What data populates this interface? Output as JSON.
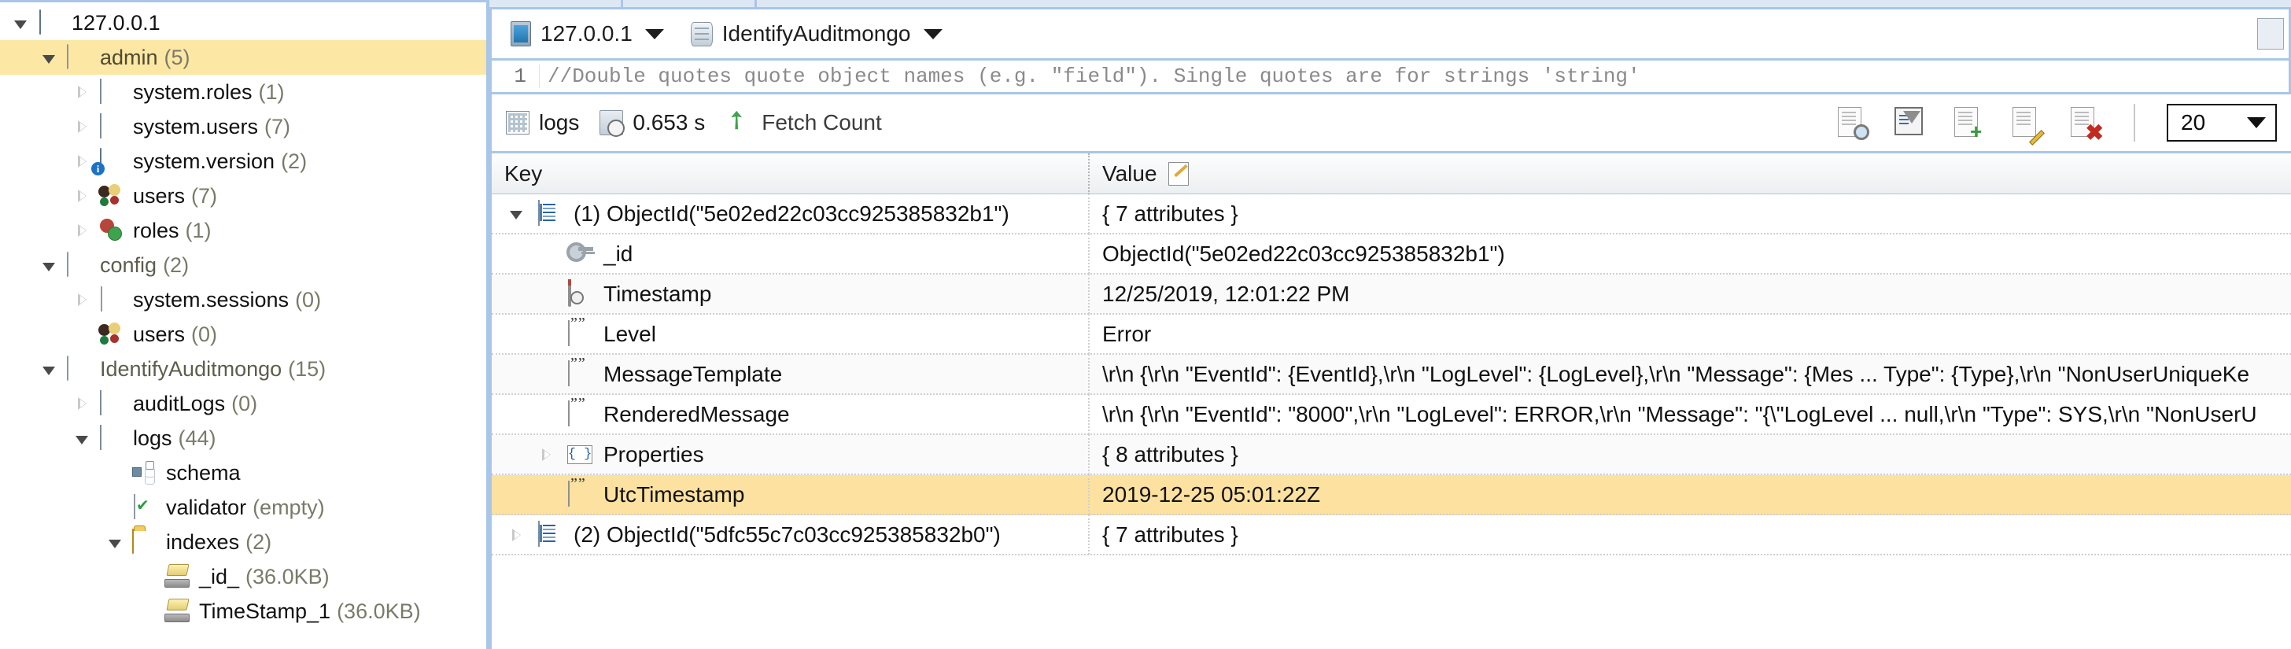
{
  "sidebar": {
    "items": [
      {
        "label": "127.0.0.1",
        "count": "",
        "icon": "server-icon",
        "indent": 0,
        "twisty": "open",
        "selected": false,
        "type": "server"
      },
      {
        "label": "admin",
        "count": "(5)",
        "icon": "database-icon",
        "indent": 1,
        "twisty": "open",
        "selected": true,
        "type": "db"
      },
      {
        "label": "system.roles",
        "count": "(1)",
        "icon": "collection-grid-icon",
        "indent": 2,
        "twisty": "closed",
        "selected": false,
        "type": "coll"
      },
      {
        "label": "system.users",
        "count": "(7)",
        "icon": "collection-grid-icon",
        "indent": 2,
        "twisty": "closed",
        "selected": false,
        "type": "coll"
      },
      {
        "label": "system.version",
        "count": "(2)",
        "icon": "server-info-icon",
        "indent": 2,
        "twisty": "closed",
        "selected": false,
        "type": "coll"
      },
      {
        "label": "users",
        "count": "(7)",
        "icon": "users-icon",
        "indent": 2,
        "twisty": "closed",
        "selected": false,
        "type": "coll"
      },
      {
        "label": "roles",
        "count": "(1)",
        "icon": "roles-icon",
        "indent": 2,
        "twisty": "closed",
        "selected": false,
        "type": "coll"
      },
      {
        "label": "config",
        "count": "(2)",
        "icon": "database-icon",
        "indent": 1,
        "twisty": "open",
        "selected": false,
        "type": "db"
      },
      {
        "label": "system.sessions",
        "count": "(0)",
        "icon": "blank-collection-icon",
        "indent": 2,
        "twisty": "closed",
        "selected": false,
        "type": "coll"
      },
      {
        "label": "users",
        "count": "(0)",
        "icon": "users-icon",
        "indent": 2,
        "twisty": "none",
        "selected": false,
        "type": "coll"
      },
      {
        "label": "IdentifyAuditmongo",
        "count": "(15)",
        "icon": "database-icon",
        "indent": 1,
        "twisty": "open",
        "selected": false,
        "type": "db"
      },
      {
        "label": "auditLogs",
        "count": "(0)",
        "icon": "collection-grid-icon",
        "indent": 2,
        "twisty": "closed",
        "selected": false,
        "type": "coll"
      },
      {
        "label": "logs",
        "count": "(44)",
        "icon": "collection-grid-icon",
        "indent": 2,
        "twisty": "open",
        "selected": false,
        "type": "coll"
      },
      {
        "label": "schema",
        "count": "",
        "icon": "schema-icon",
        "indent": 3,
        "twisty": "none",
        "selected": false,
        "type": "leaf"
      },
      {
        "label": "validator",
        "count": "(empty)",
        "icon": "validator-icon",
        "indent": 3,
        "twisty": "none",
        "selected": false,
        "type": "leaf"
      },
      {
        "label": "indexes",
        "count": "(2)",
        "icon": "folder-icon",
        "indent": 3,
        "twisty": "open",
        "selected": false,
        "type": "folder"
      },
      {
        "label": "_id_",
        "count": "(36.0KB)",
        "icon": "index-icon",
        "indent": 4,
        "twisty": "none",
        "selected": false,
        "type": "leaf"
      },
      {
        "label": "TimeStamp_1",
        "count": "(36.0KB)",
        "icon": "index-icon",
        "indent": 4,
        "twisty": "none",
        "selected": false,
        "type": "leaf"
      }
    ]
  },
  "breadcrumb": {
    "host": "127.0.0.1",
    "host_icon": "server-icon",
    "database": "IdentifyAuditmongo",
    "database_icon": "database-icon",
    "caret_icon": "chevron-down-icon"
  },
  "editor": {
    "line_number": "1",
    "code": "//Double quotes quote object names (e.g. \"field\"). Single quotes are for strings 'string'"
  },
  "results_toolbar": {
    "collection_name": "logs",
    "collection_icon": "collection-grid-icon",
    "duration": "0.653 s",
    "duration_icon": "clock-icon",
    "fetch_label": "Fetch Count",
    "fetch_icon": "green-arrow-icon",
    "limit_value": "20",
    "limit_caret": "chevron-down-icon",
    "buttons": [
      {
        "name": "view-document-button",
        "icon": "document-magnifier-icon"
      },
      {
        "name": "filter-fields-button",
        "icon": "filter-icon"
      },
      {
        "name": "insert-document-button",
        "icon": "document-plus-icon"
      },
      {
        "name": "edit-document-button",
        "icon": "document-pencil-icon"
      },
      {
        "name": "delete-document-button",
        "icon": "document-delete-icon"
      }
    ]
  },
  "table": {
    "columns": {
      "key": "Key",
      "value": "Value",
      "value_icon": "note-edit-icon"
    },
    "rows": [
      {
        "key": "(1) ObjectId(\"5e02ed22c03cc925385832b1\")",
        "value": "{ 7 attributes }",
        "icon": "document-object-icon",
        "twisty": "open",
        "indent": 0,
        "selected": false,
        "alt": false
      },
      {
        "key": "_id",
        "value": "ObjectId(\"5e02ed22c03cc925385832b1\")",
        "icon": "primary-key-icon",
        "twisty": "none",
        "indent": 1,
        "selected": false,
        "alt": false
      },
      {
        "key": "Timestamp",
        "value": "12/25/2019, 12:01:22 PM",
        "icon": "calendar-clock-icon",
        "twisty": "none",
        "indent": 1,
        "selected": false,
        "alt": true
      },
      {
        "key": "Level",
        "value": "Error",
        "icon": "string-icon",
        "twisty": "none",
        "indent": 1,
        "selected": false,
        "alt": false
      },
      {
        "key": "MessageTemplate",
        "value": "\\r\\n {\\r\\n \"EventId\": {EventId},\\r\\n \"LogLevel\": {LogLevel},\\r\\n \"Message\": {Mes ... Type\": {Type},\\r\\n \"NonUserUniqueKe",
        "icon": "string-icon",
        "twisty": "none",
        "indent": 1,
        "selected": false,
        "alt": true
      },
      {
        "key": "RenderedMessage",
        "value": "\\r\\n {\\r\\n \"EventId\": \"8000\",\\r\\n \"LogLevel\": ERROR,\\r\\n \"Message\": \"{\\\"LogLevel ... null,\\r\\n \"Type\": SYS,\\r\\n \"NonUserU",
        "icon": "string-icon",
        "twisty": "none",
        "indent": 1,
        "selected": false,
        "alt": false
      },
      {
        "key": "Properties",
        "value": "{ 8 attributes }",
        "icon": "object-braces-icon",
        "twisty": "closed",
        "indent": 1,
        "selected": false,
        "alt": true
      },
      {
        "key": "UtcTimestamp",
        "value": "2019-12-25 05:01:22Z",
        "icon": "string-icon",
        "twisty": "none",
        "indent": 1,
        "selected": true,
        "alt": false
      },
      {
        "key": "(2) ObjectId(\"5dfc55c7c03cc925385832b0\")",
        "value": "{ 7 attributes }",
        "icon": "document-object-icon",
        "twisty": "closed",
        "indent": 0,
        "selected": false,
        "alt": false
      }
    ]
  },
  "colors": {
    "selection": "#fce1a0",
    "panel_border": "#a9c6e8",
    "tree_selection": "#fce7a4"
  }
}
